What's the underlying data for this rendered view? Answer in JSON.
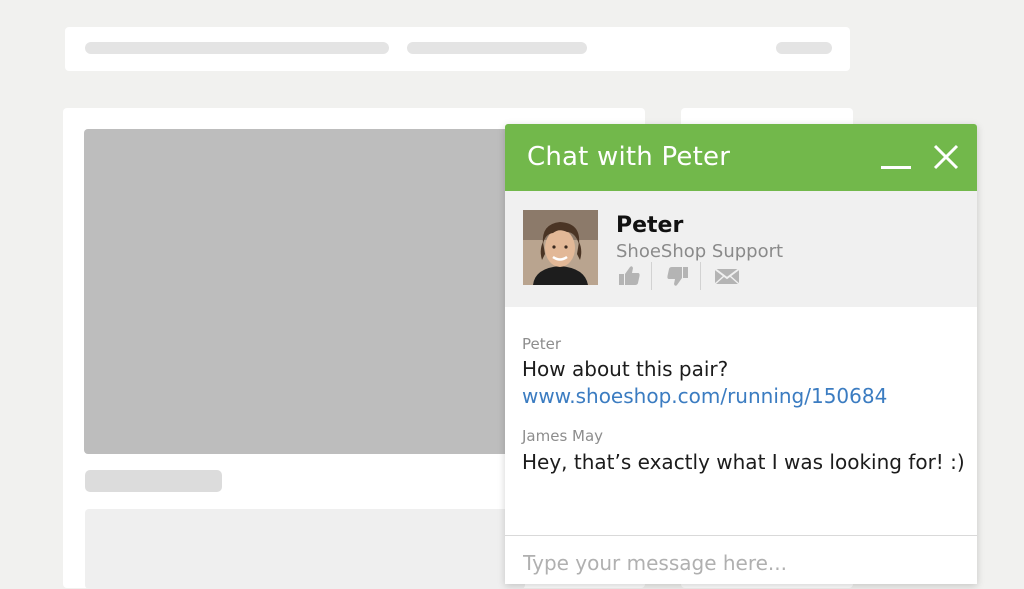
{
  "chat": {
    "title": "Chat with Peter",
    "header_color": "#72b84b",
    "agent": {
      "name": "Peter",
      "role": "ShoeShop Support",
      "actions": [
        "thumbs-up-icon",
        "thumbs-down-icon",
        "envelope-icon"
      ]
    },
    "messages": [
      {
        "author": "Peter",
        "text": "How about this pair?",
        "link": "www.shoeshop.com/running/150684"
      },
      {
        "author": "James May",
        "text": "Hey, that’s exactly what I was looking for! :)"
      }
    ],
    "input_placeholder": "Type your message here..."
  }
}
